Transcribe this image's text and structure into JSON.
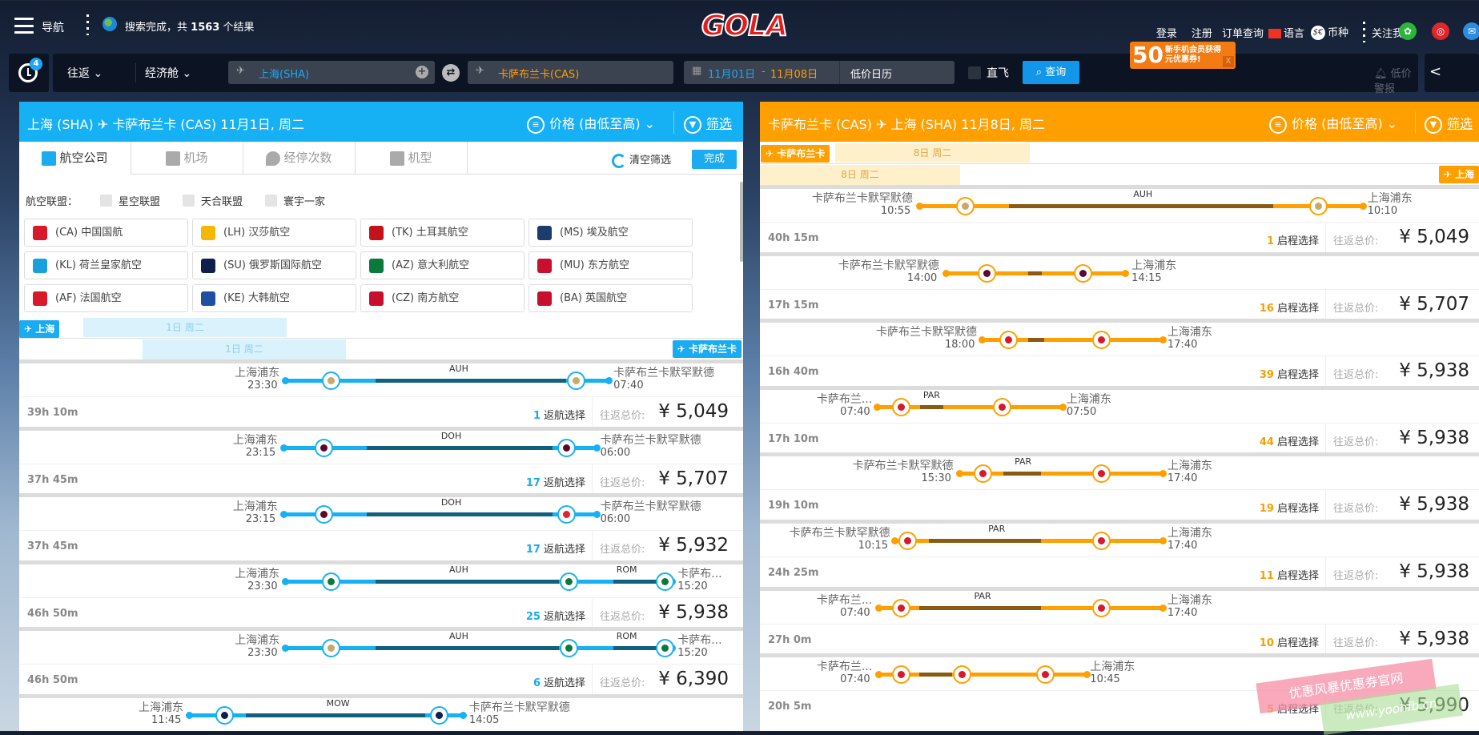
{
  "topbar": {
    "nav_label": "导航",
    "status_prefix": "搜索完成，共",
    "result_count": "1563",
    "status_suffix": "个结果",
    "logo": "GOLA",
    "login": "登录",
    "register": "注册",
    "orders": "订单查询",
    "language": "语言",
    "currency": "币种",
    "follow": "关注我们",
    "promo": {
      "amount": "50",
      "line1": "新手机会员获得",
      "line2": "元优惠券!",
      "close": "X"
    }
  },
  "search": {
    "history_count": "4",
    "trip_type": "往返",
    "cabin": "经济舱",
    "from": "上海(SHA)",
    "to": "卡萨布兰卡(CAS)",
    "date_start": "11月01日",
    "date_sep": "-",
    "date_end": "11月08日",
    "calendar": "低价日历",
    "direct": "直飞",
    "search_btn": "查询",
    "price_alert": "低价警报"
  },
  "colors": {
    "outbound": "#16b1f5",
    "inbound": "#ff9f00",
    "dark_outbound": "#11607f",
    "dark_inbound": "#8a5a12"
  },
  "outbound": {
    "from": "上海 (SHA)",
    "to": "卡萨布兰卡 (CAS)",
    "date": "11月1日, 周二",
    "sort": "价格 (由低至高)",
    "filter": "筛选",
    "tabs": [
      "航空公司",
      "机场",
      "经停次数",
      "机型"
    ],
    "clear": "清空筛选",
    "done": "完成",
    "alliance_label": "航空联盟：",
    "alliances": [
      "星空联盟",
      "天合联盟",
      "寰宇一家"
    ],
    "airlines": [
      {
        "name": "(CA) 中国国航",
        "color": "#d7192a"
      },
      {
        "name": "(LH) 汉莎航空",
        "color": "#f5b800"
      },
      {
        "name": "(TK) 土耳其航空",
        "color": "#c4121a"
      },
      {
        "name": "(MS) 埃及航空",
        "color": "#1d3c6e"
      },
      {
        "name": "(KL) 荷兰皇家航空",
        "color": "#18a0dc"
      },
      {
        "name": "(SU) 俄罗斯国际航空",
        "color": "#0d1f4c"
      },
      {
        "name": "(AZ) 意大利航空",
        "color": "#0a7a3c"
      },
      {
        "name": "(MU) 东方航空",
        "color": "#c8102e"
      },
      {
        "name": "(AF) 法国航空",
        "color": "#d7192a"
      },
      {
        "name": "(KE) 大韩航空",
        "color": "#1e4fa0"
      },
      {
        "name": "(CZ) 南方航空",
        "color": "#c8102e"
      },
      {
        "name": "(BA) 英国航空",
        "color": "#c8102e"
      }
    ],
    "dep_badge": "上海",
    "dep_date": "1日 周二",
    "arr_badge": "卡萨布兰卡",
    "arr_date": "1日 周二",
    "count_label": "返航选择",
    "total_label": "往返总价:",
    "flights": [
      {
        "dep": "上海浦东",
        "dep_time": "23:30",
        "arr": "卡萨布兰卡默罕默德",
        "arr_time": "07:40",
        "via": [
          "AUH"
        ],
        "nodes": [
          "EY",
          "EY"
        ],
        "duration": "39h 10m",
        "count": "1",
        "price": "¥ 5,049"
      },
      {
        "dep": "上海浦东",
        "dep_time": "23:15",
        "arr": "卡萨布兰卡默罕默德",
        "arr_time": "06:00",
        "via": [
          "DOH"
        ],
        "nodes": [
          "QR",
          "QR"
        ],
        "duration": "37h 45m",
        "count": "17",
        "price": "¥ 5,707"
      },
      {
        "dep": "上海浦东",
        "dep_time": "23:15",
        "arr": "卡萨布兰卡默罕默德",
        "arr_time": "06:00",
        "via": [
          "DOH"
        ],
        "nodes": [
          "QR",
          "AT"
        ],
        "duration": "37h 45m",
        "count": "17",
        "price": "¥ 5,932"
      },
      {
        "dep": "上海浦东",
        "dep_time": "23:30",
        "arr": "卡萨布...",
        "arr_time": "15:20",
        "via": [
          "AUH",
          "ROM"
        ],
        "nodes": [
          "AZ",
          "AZ",
          "AZ"
        ],
        "duration": "46h 50m",
        "count": "25",
        "price": "¥ 5,938"
      },
      {
        "dep": "上海浦东",
        "dep_time": "23:30",
        "arr": "卡萨布...",
        "arr_time": "15:20",
        "via": [
          "AUH",
          "ROM"
        ],
        "nodes": [
          "EY",
          "AZ",
          "AZ"
        ],
        "duration": "46h 50m",
        "count": "6",
        "price": "¥ 6,390"
      },
      {
        "dep": "上海浦东",
        "dep_time": "11:45",
        "arr": "卡萨布兰卡默罕默德",
        "arr_time": "14:05",
        "via": [
          "MOW"
        ],
        "nodes": [
          "SU",
          "SU"
        ],
        "duration": "",
        "count": "",
        "price": ""
      }
    ]
  },
  "inbound": {
    "from": "卡萨布兰卡 (CAS)",
    "to": "上海 (SHA)",
    "date": "11月8日, 周二",
    "sort": "价格 (由低至高)",
    "filter": "筛选",
    "dep_badge": "卡萨布兰卡",
    "dep_date": "8日 周二",
    "arr_badge": "上海",
    "arr_date": "8日 周二",
    "count_label": "启程选择",
    "total_label": "往返总价:",
    "flights": [
      {
        "dep": "卡萨布兰卡默罕默德",
        "dep_time": "10:55",
        "arr": "上海浦东",
        "arr_time": "10:10",
        "via": [
          "AUH"
        ],
        "nodes": [
          "EY",
          "EY"
        ],
        "duration": "40h 15m",
        "count": "1",
        "price": "¥ 5,049"
      },
      {
        "dep": "卡萨布兰卡默罕默德",
        "dep_time": "14:00",
        "arr": "上海浦东",
        "arr_time": "14:15",
        "via": [
          ""
        ],
        "nodes": [
          "QR",
          "QR"
        ],
        "duration": "17h 15m",
        "count": "16",
        "price": "¥ 5,707"
      },
      {
        "dep": "卡萨布兰卡默罕默德",
        "dep_time": "18:00",
        "arr": "上海浦东",
        "arr_time": "17:40",
        "via": [
          ""
        ],
        "nodes": [
          "AF",
          "AF"
        ],
        "duration": "16h 40m",
        "count": "39",
        "price": "¥ 5,938"
      },
      {
        "dep": "卡萨布兰...",
        "dep_time": "07:40",
        "arr": "上海浦东",
        "arr_time": "07:50",
        "via": [
          "PAR"
        ],
        "nodes": [
          "AF",
          "AF"
        ],
        "duration": "17h 10m",
        "count": "44",
        "price": "¥ 5,938"
      },
      {
        "dep": "卡萨布兰卡默罕默德",
        "dep_time": "15:30",
        "arr": "上海浦东",
        "arr_time": "17:40",
        "via": [
          "PAR"
        ],
        "nodes": [
          "AF",
          "AF"
        ],
        "duration": "19h 10m",
        "count": "19",
        "price": "¥ 5,938"
      },
      {
        "dep": "卡萨布兰卡默罕默德",
        "dep_time": "10:15",
        "arr": "上海浦东",
        "arr_time": "17:40",
        "via": [
          "PAR"
        ],
        "nodes": [
          "AF",
          "AF"
        ],
        "duration": "24h 25m",
        "count": "11",
        "price": "¥ 5,938"
      },
      {
        "dep": "卡萨布兰...",
        "dep_time": "07:40",
        "arr": "上海浦东",
        "arr_time": "17:40",
        "via": [
          "PAR"
        ],
        "nodes": [
          "AF",
          "AF"
        ],
        "duration": "27h 0m",
        "count": "10",
        "price": "¥ 5,938"
      },
      {
        "dep": "卡萨布兰...",
        "dep_time": "07:40",
        "arr": "上海浦东",
        "arr_time": "10:45",
        "via": [
          ""
        ],
        "nodes": [
          "AF",
          "AF",
          "AF"
        ],
        "duration": "20h 5m",
        "count": "5",
        "price": "¥ 5,990"
      }
    ]
  },
  "watermark": {
    "line1": "优惠风暴优惠券官网",
    "line2": "www.yoohfb.cn"
  }
}
